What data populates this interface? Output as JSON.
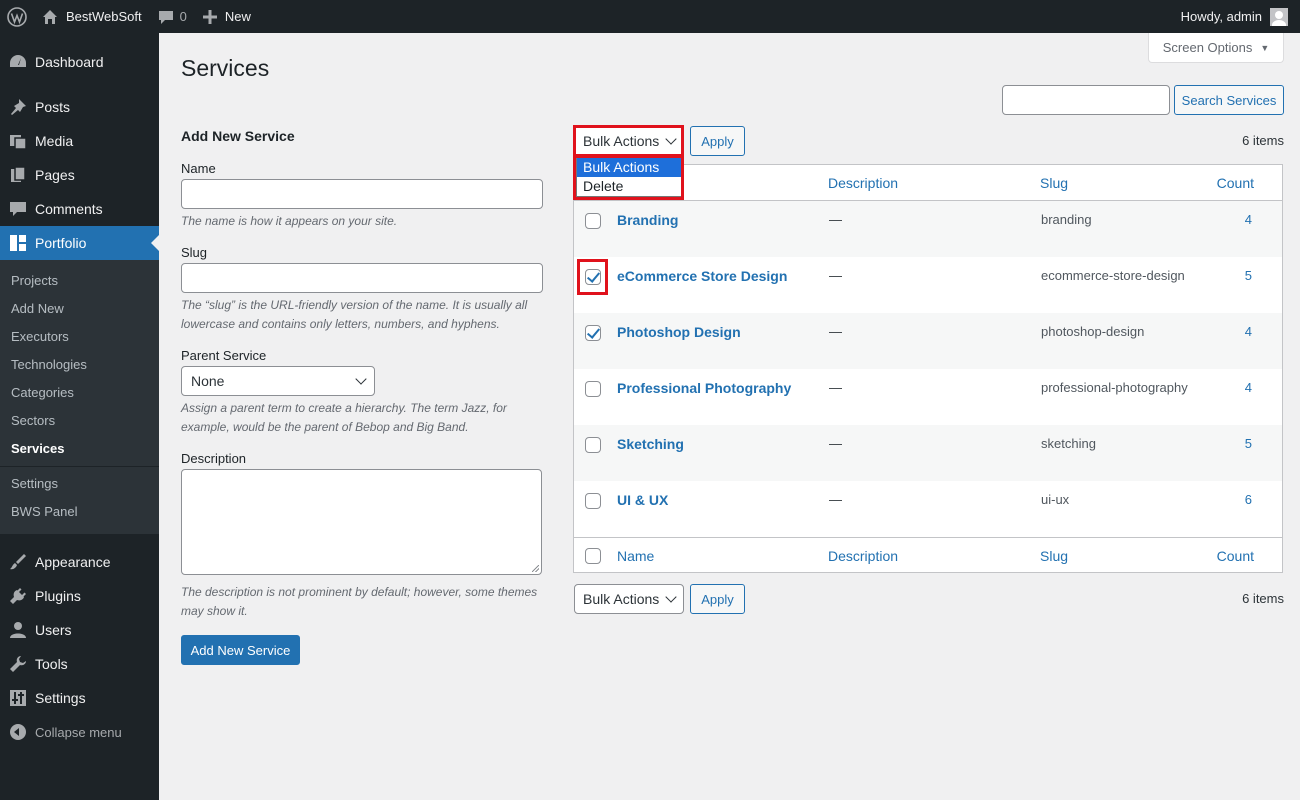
{
  "admin_bar": {
    "site_name": "BestWebSoft",
    "comments_count": "0",
    "new_label": "New",
    "howdy": "Howdy, admin"
  },
  "sidebar": {
    "top_items": [
      {
        "label": "Dashboard",
        "icon": "dashboard-icon"
      },
      {
        "label": "Posts",
        "icon": "pin-icon"
      },
      {
        "label": "Media",
        "icon": "media-icon"
      },
      {
        "label": "Pages",
        "icon": "pages-icon"
      },
      {
        "label": "Comments",
        "icon": "comment-icon"
      },
      {
        "label": "Portfolio",
        "icon": "grid-icon"
      }
    ],
    "submenu": [
      "Projects",
      "Add New",
      "Executors",
      "Technologies",
      "Categories",
      "Sectors",
      "Services",
      "Settings",
      "BWS Panel"
    ],
    "bottom_items": [
      {
        "label": "Appearance",
        "icon": "brush-icon"
      },
      {
        "label": "Plugins",
        "icon": "plug-icon"
      },
      {
        "label": "Users",
        "icon": "user-icon"
      },
      {
        "label": "Tools",
        "icon": "wrench-icon"
      },
      {
        "label": "Settings",
        "icon": "settings-icon"
      }
    ],
    "collapse_label": "Collapse menu"
  },
  "screen_options": "Screen Options",
  "page_title": "Services",
  "search": {
    "button": "Search Services",
    "value": ""
  },
  "form": {
    "heading": "Add New Service",
    "name_label": "Name",
    "name_help": "The name is how it appears on your site.",
    "slug_label": "Slug",
    "slug_help": "The “slug” is the URL-friendly version of the name. It is usually all lowercase and contains only letters, numbers, and hyphens.",
    "parent_label": "Parent Service",
    "parent_value": "None",
    "parent_help": "Assign a parent term to create a hierarchy. The term Jazz, for example, would be the parent of Bebop and Big Band.",
    "description_label": "Description",
    "description_help": "The description is not prominent by default; however, some themes may show it.",
    "submit": "Add New Service"
  },
  "bulk": {
    "label": "Bulk Actions",
    "apply": "Apply",
    "options": [
      "Bulk Actions",
      "Delete"
    ],
    "items_count": "6 items"
  },
  "table": {
    "columns": [
      "Name",
      "Description",
      "Slug",
      "Count"
    ],
    "rows": [
      {
        "name": "Branding",
        "description": "—",
        "slug": "branding",
        "count": "4",
        "checked": false
      },
      {
        "name": "eCommerce Store Design",
        "description": "—",
        "slug": "ecommerce-store-design",
        "count": "5",
        "checked": true
      },
      {
        "name": "Photoshop Design",
        "description": "—",
        "slug": "photoshop-design",
        "count": "4",
        "checked": true
      },
      {
        "name": "Professional Photography",
        "description": "—",
        "slug": "professional-photography",
        "count": "4",
        "checked": false
      },
      {
        "name": "Sketching",
        "description": "—",
        "slug": "sketching",
        "count": "5",
        "checked": false
      },
      {
        "name": "UI & UX",
        "description": "—",
        "slug": "ui-ux",
        "count": "6",
        "checked": false
      }
    ]
  },
  "colors": {
    "accent": "#2271b1",
    "sidebar": "#1d2327",
    "highlight": "#e0121c"
  }
}
